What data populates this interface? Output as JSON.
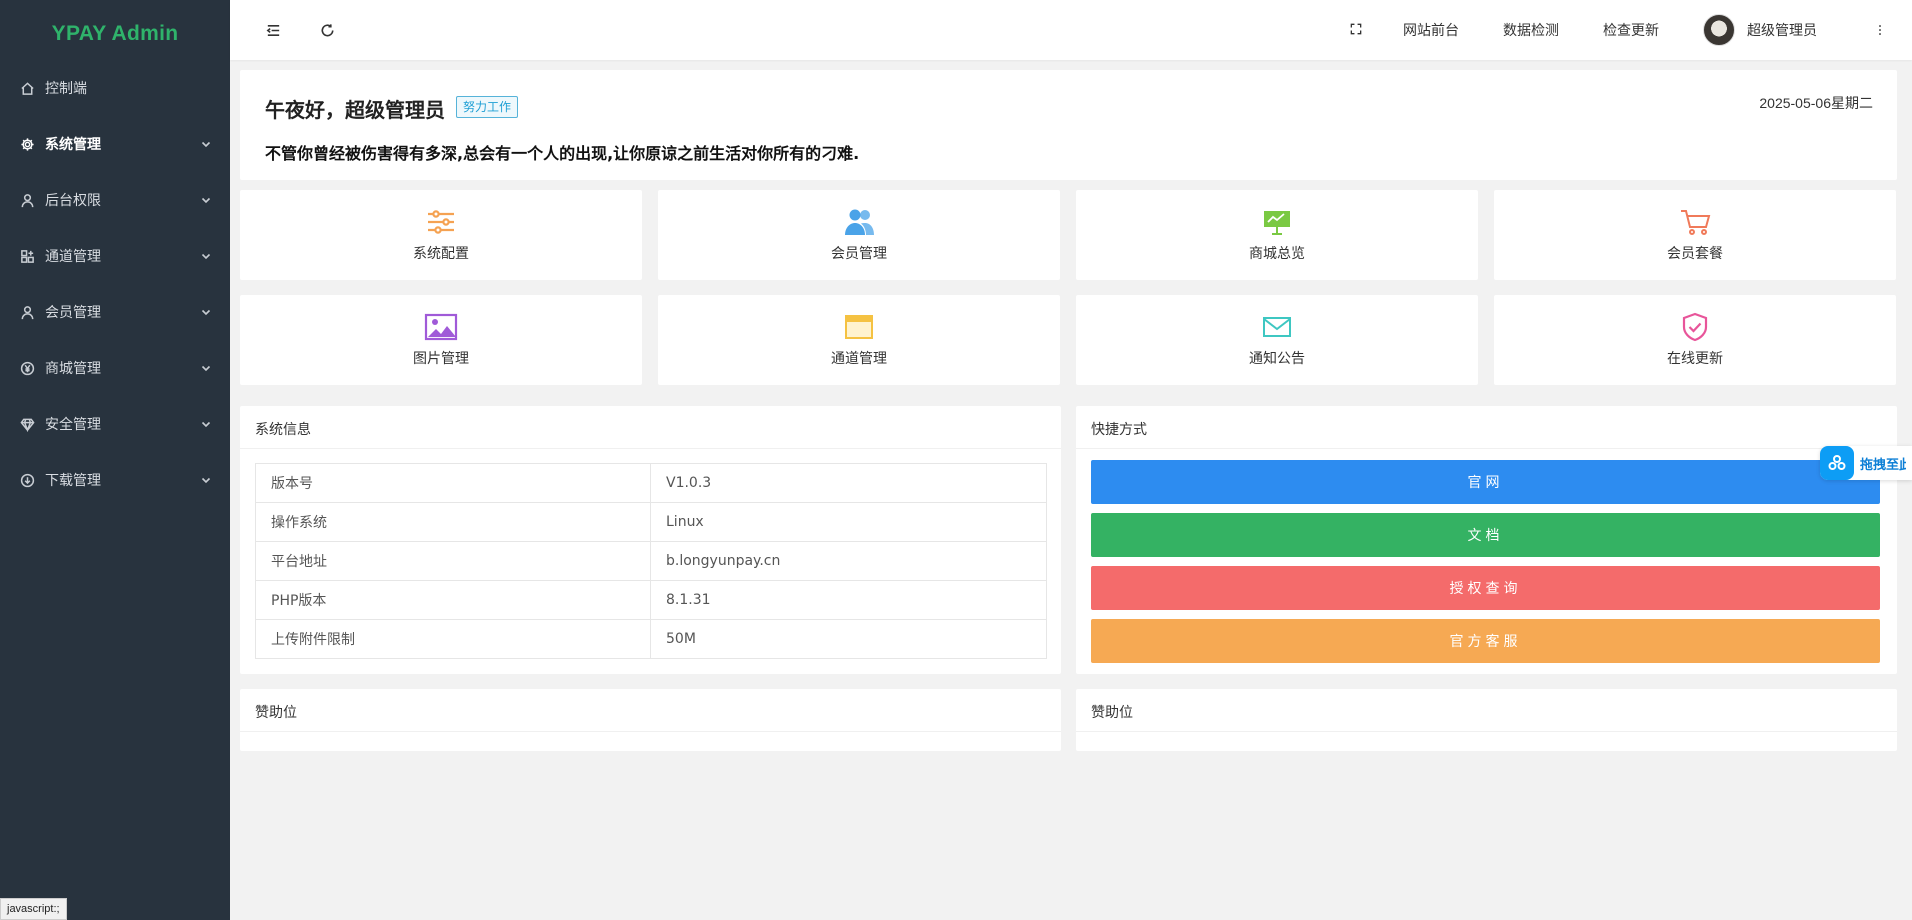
{
  "app": {
    "logo": "YPAY Admin"
  },
  "sidebar": {
    "items": [
      {
        "label": "控制端",
        "icon": "home-icon"
      },
      {
        "label": "系统管理",
        "icon": "gear-icon"
      },
      {
        "label": "后台权限",
        "icon": "user-icon"
      },
      {
        "label": "通道管理",
        "icon": "apps-icon"
      },
      {
        "label": "会员管理",
        "icon": "user-icon"
      },
      {
        "label": "商城管理",
        "icon": "yen-icon"
      },
      {
        "label": "安全管理",
        "icon": "diamond-icon"
      },
      {
        "label": "下载管理",
        "icon": "download-icon"
      }
    ]
  },
  "status_bar": {
    "text": "javascript:;"
  },
  "header": {
    "links": [
      "网站前台",
      "数据检测",
      "检查更新"
    ],
    "user_name": "超级管理员"
  },
  "welcome": {
    "greeting": "午夜好，超级管理员",
    "tag": "努力工作",
    "date": "2025-05-06星期二",
    "quote": "不管你曾经被伤害得有多深,总会有一个人的出现,让你原谅之前生活对你所有的刁难."
  },
  "tiles": [
    {
      "label": "系统配置",
      "icon": "sliders-icon",
      "color": "#f5a252"
    },
    {
      "label": "会员管理",
      "icon": "users-icon",
      "color": "#4aa3e8"
    },
    {
      "label": "商城总览",
      "icon": "presentation-icon",
      "color": "#7ac943"
    },
    {
      "label": "会员套餐",
      "icon": "cart-icon",
      "color": "#f07a5a"
    },
    {
      "label": "图片管理",
      "icon": "image-icon",
      "color": "#a05ad8"
    },
    {
      "label": "通道管理",
      "icon": "window-icon",
      "color": "#f5c242"
    },
    {
      "label": "通知公告",
      "icon": "mail-icon",
      "color": "#3ec7c2"
    },
    {
      "label": "在线更新",
      "icon": "shield-check-icon",
      "color": "#e8559a"
    }
  ],
  "system_info": {
    "title": "系统信息",
    "rows": [
      {
        "key": "版本号",
        "value": "V1.0.3"
      },
      {
        "key": "操作系统",
        "value": "Linux"
      },
      {
        "key": "平台地址",
        "value": "b.longyunpay.cn"
      },
      {
        "key": "PHP版本",
        "value": "8.1.31"
      },
      {
        "key": "上传附件限制",
        "value": "50M"
      }
    ]
  },
  "shortcuts": {
    "title": "快捷方式",
    "buttons": [
      {
        "label": "官网",
        "color": "#2d8cf0"
      },
      {
        "label": "文档",
        "color": "#34b263"
      },
      {
        "label": "授权查询",
        "color": "#f46b6b"
      },
      {
        "label": "官方客服",
        "color": "#f6a953"
      }
    ]
  },
  "sponsor_left": {
    "title": "赞助位"
  },
  "sponsor_right": {
    "title": "赞助位"
  },
  "drag_chip": {
    "text": "拖拽至此"
  }
}
